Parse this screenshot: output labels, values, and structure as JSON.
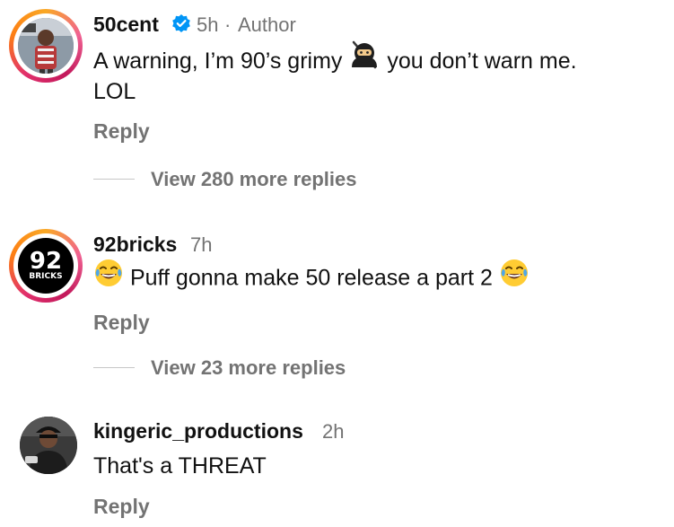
{
  "comments": [
    {
      "username": "50cent",
      "verified": true,
      "time": "5h",
      "separator": "·",
      "author_label": "Author",
      "text_part1": "A warning,  I’m 90’s grimy ",
      "text_emoji": "ninja",
      "text_part2": " you don’t warn me.",
      "text_line2": "LOL",
      "reply_label": "Reply",
      "view_more": "View 280 more replies"
    },
    {
      "username": "92bricks",
      "time": "7h",
      "avatar_text_top": "92",
      "avatar_text_bottom": "BRICKS",
      "text_emoji_lead": "face-with-tears-of-joy",
      "text": " Puff gonna make 50 release a part 2 ",
      "text_emoji_trail": "face-with-tears-of-joy",
      "reply_label": "Reply",
      "view_more": "View 23 more replies"
    },
    {
      "username": "kingeric_productions",
      "time": "2h",
      "text": "That's a THREAT",
      "reply_label": "Reply"
    }
  ],
  "colors": {
    "text_primary": "#111111",
    "text_secondary": "#737373",
    "verified_blue": "#0095f6",
    "emoji_yellow": "#ffcc33"
  }
}
